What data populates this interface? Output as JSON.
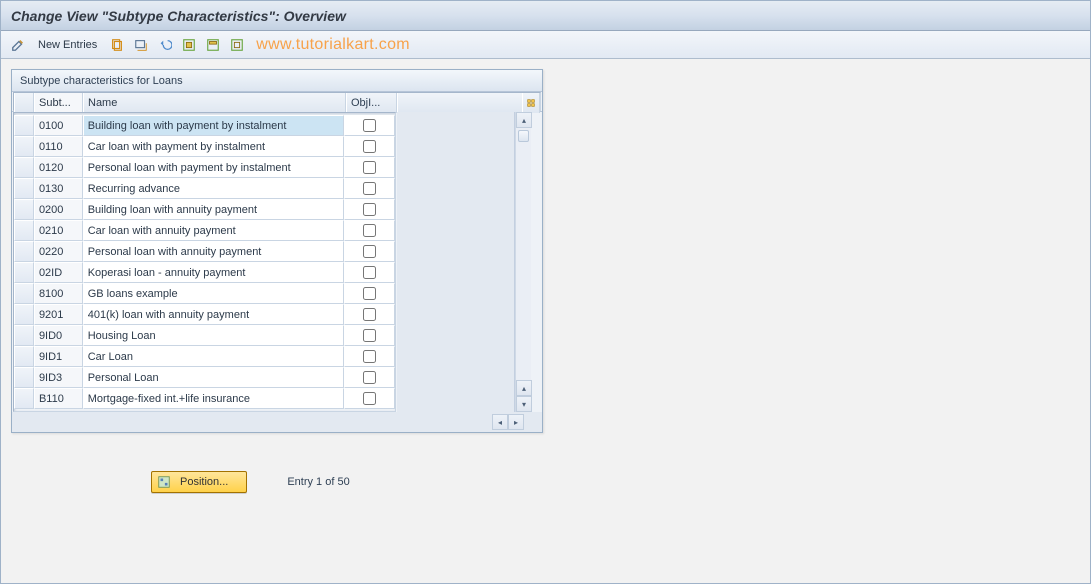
{
  "header": {
    "title": "Change View \"Subtype Characteristics\": Overview"
  },
  "toolbar": {
    "new_entries_label": "New Entries"
  },
  "watermark": "www.tutorialkart.com",
  "grid": {
    "title": "Subtype characteristics for Loans",
    "columns": {
      "subtype": "Subt...",
      "name": "Name",
      "objindic": "ObjI..."
    },
    "rows": [
      {
        "subtype": "0100",
        "name": "Building loan with payment by instalment",
        "obji": false,
        "selected": true
      },
      {
        "subtype": "0110",
        "name": "Car loan with payment by instalment",
        "obji": false
      },
      {
        "subtype": "0120",
        "name": "Personal loan with payment by instalment",
        "obji": false
      },
      {
        "subtype": "0130",
        "name": "Recurring advance",
        "obji": false
      },
      {
        "subtype": "0200",
        "name": "Building loan with annuity payment",
        "obji": false
      },
      {
        "subtype": "0210",
        "name": "Car loan with annuity payment",
        "obji": false
      },
      {
        "subtype": "0220",
        "name": "Personal loan with annuity payment",
        "obji": false
      },
      {
        "subtype": "02ID",
        "name": "Koperasi loan - annuity payment",
        "obji": false
      },
      {
        "subtype": "8100",
        "name": "GB loans example",
        "obji": false
      },
      {
        "subtype": "9201",
        "name": "401(k) loan with annuity payment",
        "obji": false
      },
      {
        "subtype": "9ID0",
        "name": "Housing Loan",
        "obji": false
      },
      {
        "subtype": "9ID1",
        "name": "Car Loan",
        "obji": false
      },
      {
        "subtype": "9ID3",
        "name": "Personal Loan",
        "obji": false
      },
      {
        "subtype": "B110",
        "name": "Mortgage-fixed int.+life insurance",
        "obji": false
      }
    ]
  },
  "footer": {
    "position_label": "Position...",
    "entry_text": "Entry 1 of 50"
  }
}
